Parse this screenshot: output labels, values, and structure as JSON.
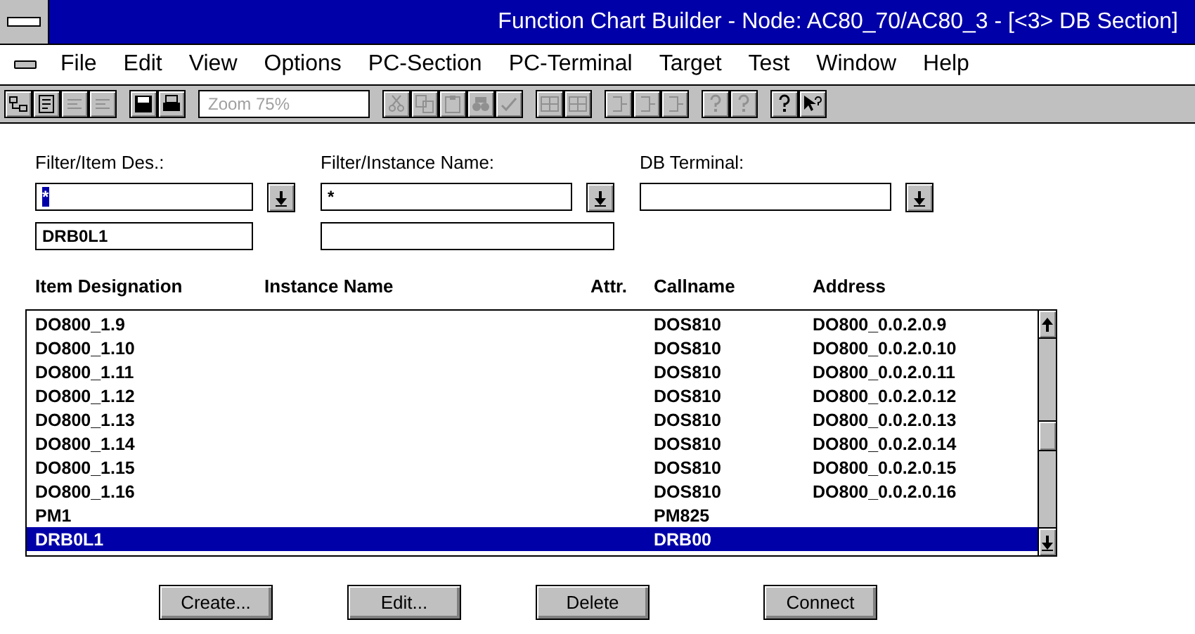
{
  "window": {
    "title": "Function Chart Builder - Node: AC80_70/AC80_3 - [<3> DB Section]"
  },
  "menu": [
    "File",
    "Edit",
    "View",
    "Options",
    "PC-Section",
    "PC-Terminal",
    "Target",
    "Test",
    "Window",
    "Help"
  ],
  "toolbar": {
    "groups": [
      [
        {
          "kind": "tree",
          "disabled": false
        },
        {
          "kind": "page",
          "disabled": false
        },
        {
          "kind": "text",
          "disabled": true
        },
        {
          "kind": "text",
          "disabled": true
        }
      ],
      [
        {
          "kind": "save",
          "disabled": false
        },
        {
          "kind": "print",
          "disabled": false
        }
      ],
      [
        {
          "kind": "zoom"
        }
      ],
      [
        {
          "kind": "cut",
          "disabled": true
        },
        {
          "kind": "copy",
          "disabled": true
        },
        {
          "kind": "paste",
          "disabled": true
        },
        {
          "kind": "find",
          "disabled": true
        },
        {
          "kind": "spell",
          "disabled": true
        }
      ],
      [
        {
          "kind": "grid",
          "disabled": true
        },
        {
          "kind": "grid",
          "disabled": true
        }
      ],
      [
        {
          "kind": "bracket",
          "disabled": true
        },
        {
          "kind": "bracket",
          "disabled": true
        },
        {
          "kind": "bracket",
          "disabled": true
        }
      ],
      [
        {
          "kind": "help",
          "disabled": true
        },
        {
          "kind": "help",
          "disabled": true
        }
      ],
      [
        {
          "kind": "help",
          "disabled": false
        },
        {
          "kind": "pointer",
          "disabled": false
        }
      ]
    ],
    "zoom": {
      "placeholder": "Zoom 75%"
    }
  },
  "filters": [
    {
      "label": "Filter/Item Des.:",
      "value": "*",
      "value_selected": true,
      "dropdown": true,
      "second_field": true,
      "second_value": "DRB0L1"
    },
    {
      "label": "Filter/Instance Name:",
      "value": "*",
      "value_selected": false,
      "dropdown": true,
      "second_field": true
    },
    {
      "label": "DB Terminal:",
      "dropdown": true
    }
  ],
  "table": {
    "columns": [
      "Item Designation",
      "Instance Name",
      "Attr.",
      "Callname",
      "Address"
    ],
    "rows": [
      {
        "item": "DO800_1.9",
        "callname": "DOS810",
        "address": "DO800_0.0.2.0.9",
        "selected": false
      },
      {
        "item": "DO800_1.10",
        "callname": "DOS810",
        "address": "DO800_0.0.2.0.10",
        "selected": false
      },
      {
        "item": "DO800_1.11",
        "callname": "DOS810",
        "address": "DO800_0.0.2.0.11",
        "selected": false
      },
      {
        "item": "DO800_1.12",
        "callname": "DOS810",
        "address": "DO800_0.0.2.0.12",
        "selected": false
      },
      {
        "item": "DO800_1.13",
        "callname": "DOS810",
        "address": "DO800_0.0.2.0.13",
        "selected": false
      },
      {
        "item": "DO800_1.14",
        "callname": "DOS810",
        "address": "DO800_0.0.2.0.14",
        "selected": false
      },
      {
        "item": "DO800_1.15",
        "callname": "DOS810",
        "address": "DO800_0.0.2.0.15",
        "selected": false
      },
      {
        "item": "DO800_1.16",
        "callname": "DOS810",
        "address": "DO800_0.0.2.0.16",
        "selected": false
      },
      {
        "item": "PM1",
        "callname": "PM825",
        "address": "",
        "selected": false
      },
      {
        "item": "DRB0L1",
        "callname": "DRB00",
        "address": "",
        "selected": true
      }
    ]
  },
  "buttons": [
    "Create...",
    "Edit...",
    "Delete",
    "Connect"
  ]
}
